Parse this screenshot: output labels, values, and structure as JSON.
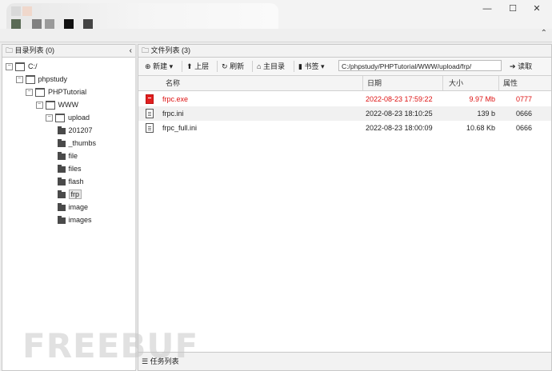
{
  "window": {
    "minimize": "—",
    "maximize": "☐",
    "close": "✕"
  },
  "left_panel": {
    "title": "目录列表 (0)",
    "tree": [
      {
        "label": "C:/",
        "level": 0,
        "expanded": true
      },
      {
        "label": "phpstudy",
        "level": 1,
        "expanded": true
      },
      {
        "label": "PHPTutorial",
        "level": 2,
        "expanded": true
      },
      {
        "label": "WWW",
        "level": 3,
        "expanded": true
      },
      {
        "label": "upload",
        "level": 4,
        "expanded": true
      },
      {
        "label": "201207",
        "level": 5
      },
      {
        "label": "_thumbs",
        "level": 5
      },
      {
        "label": "file",
        "level": 5
      },
      {
        "label": "files",
        "level": 5
      },
      {
        "label": "flash",
        "level": 5
      },
      {
        "label": "frp",
        "level": 5,
        "selected": true
      },
      {
        "label": "image",
        "level": 5
      },
      {
        "label": "images",
        "level": 5
      }
    ]
  },
  "right_panel": {
    "title": "文件列表 (3)",
    "toolbar": {
      "new": "新建",
      "up": "上层",
      "refresh": "刷新",
      "home": "主目录",
      "bookmark": "书签",
      "path": "C:/phpstudy/PHPTutorial/WWW/upload/frp/",
      "read": "读取"
    },
    "columns": {
      "name": "名称",
      "date": "日期",
      "size": "大小",
      "attr": "属性"
    },
    "files": [
      {
        "name": "frpc.exe",
        "date": "2022-08-23 17:59:22",
        "size": "9.97 Mb",
        "attr": "0777"
      },
      {
        "name": "frpc.ini",
        "date": "2022-08-23 18:10:25",
        "size": "139 b",
        "attr": "0666"
      },
      {
        "name": "frpc_full.ini",
        "date": "2022-08-23 18:00:09",
        "size": "10.68 Kb",
        "attr": "0666"
      }
    ],
    "task_list": "任务列表"
  },
  "colors": {
    "exe_text": "#d11111",
    "selected_bg": "#e8e8e8"
  }
}
